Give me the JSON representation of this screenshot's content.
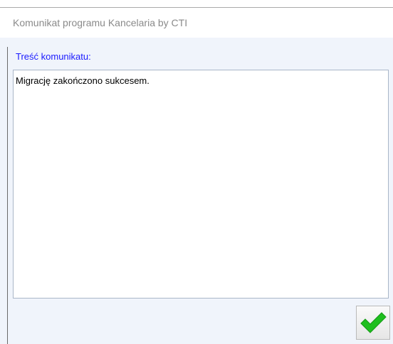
{
  "window": {
    "title": "Komunikat programu Kancelaria by CTI"
  },
  "message": {
    "group_label": "Treść komunikatu:",
    "text": "Migrację zakończono sukcesem."
  },
  "ok_button": {
    "icon": "checkmark-icon",
    "icon_color": "#1fbf1f"
  },
  "colors": {
    "label_blue": "#1a1aff",
    "client_background": "#f0f4fb"
  }
}
